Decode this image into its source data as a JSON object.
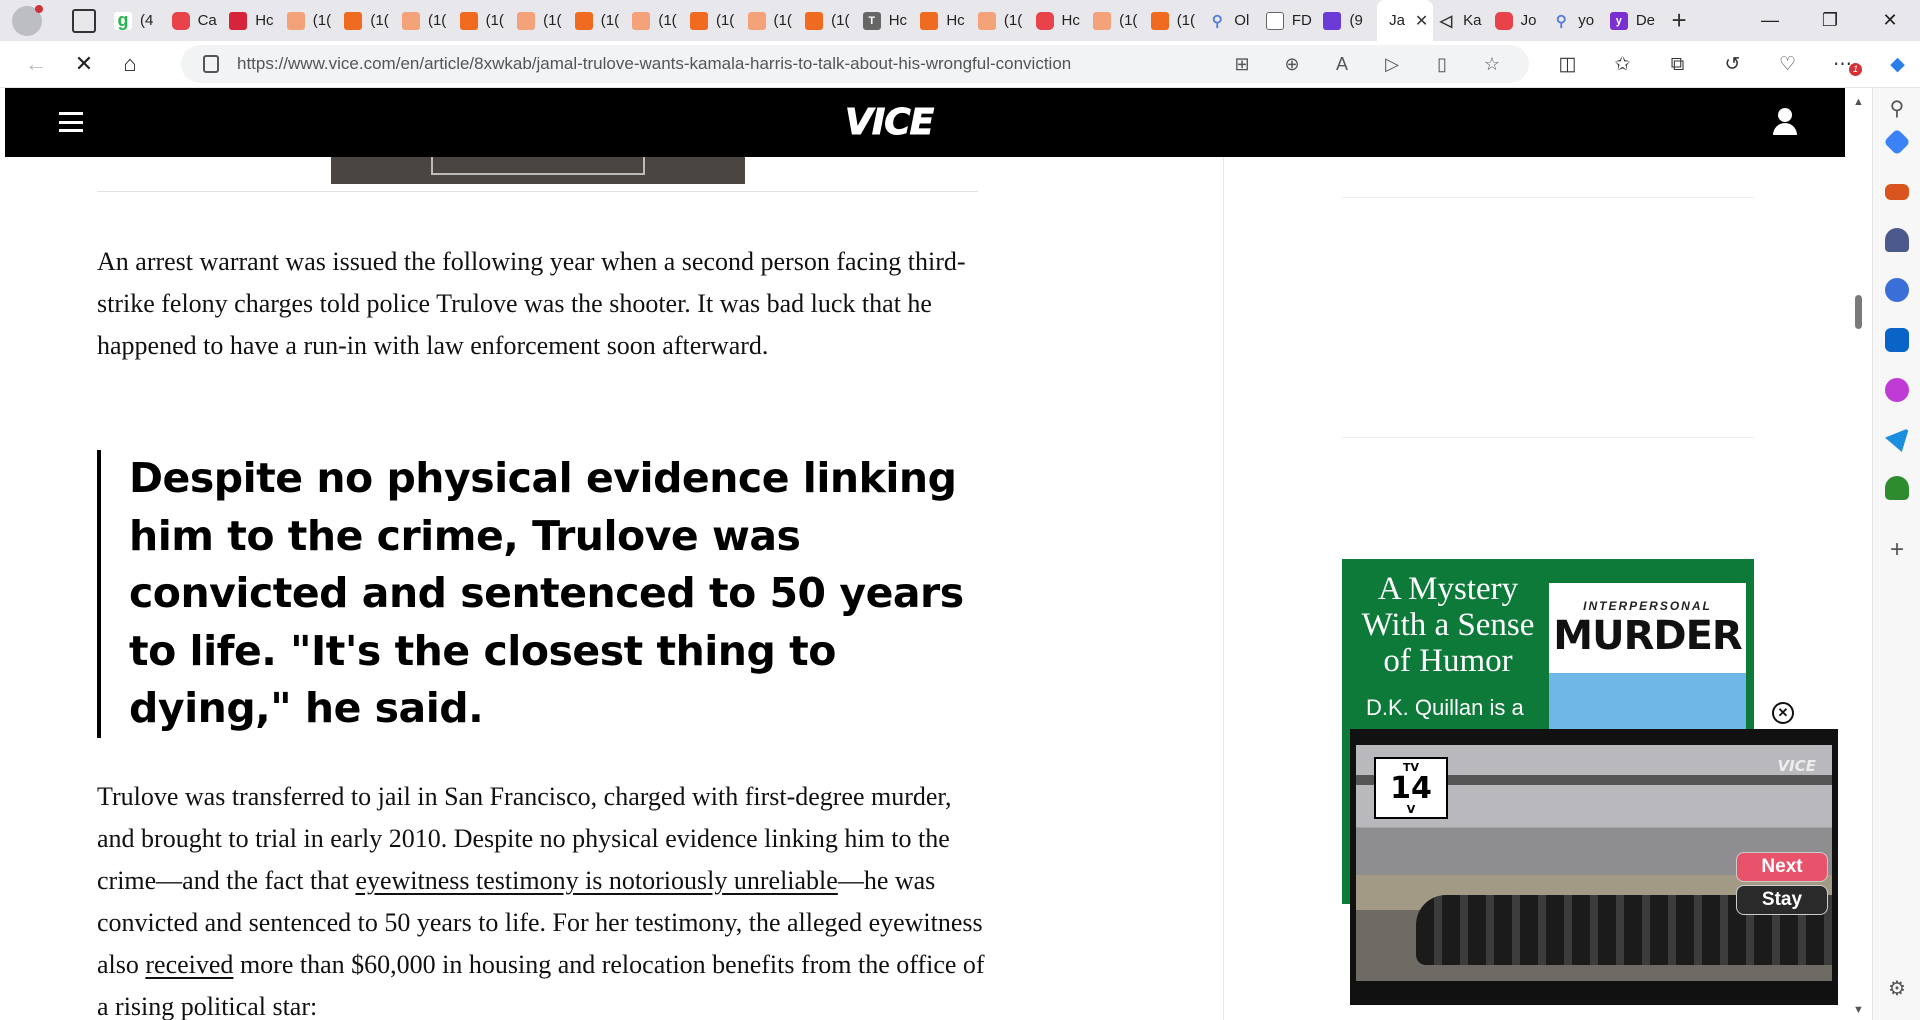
{
  "browser": {
    "tabs": [
      {
        "label": "(4",
        "icon": "grammarly-icon"
      },
      {
        "label": "Ca",
        "icon": "youtube-icon"
      },
      {
        "label": "Hc",
        "icon": "red-app-icon"
      },
      {
        "label": "(1(",
        "icon": "orange-app-icon"
      },
      {
        "label": "(1(",
        "icon": "orange-app-icon"
      },
      {
        "label": "(1(",
        "icon": "orange-app-icon"
      },
      {
        "label": "(1(",
        "icon": "orange-app-icon"
      },
      {
        "label": "(1(",
        "icon": "orange-app-icon"
      },
      {
        "label": "(1(",
        "icon": "orange-app-icon"
      },
      {
        "label": "(1(",
        "icon": "orange-app-icon"
      },
      {
        "label": "(1(",
        "icon": "orange-app-icon"
      },
      {
        "label": "(1(",
        "icon": "orange-app-icon"
      },
      {
        "label": "(1(",
        "icon": "orange-app-icon"
      },
      {
        "label": "Hc",
        "icon": "text-app-icon"
      },
      {
        "label": "Hc",
        "icon": "orange-app-icon"
      },
      {
        "label": "(1(",
        "icon": "orange-app-icon"
      },
      {
        "label": "Hc",
        "icon": "youtube-icon"
      },
      {
        "label": "(1(",
        "icon": "orange-app-icon"
      },
      {
        "label": "(1(",
        "icon": "orange-app-icon"
      },
      {
        "label": "Ol",
        "icon": "search-icon"
      },
      {
        "label": "FD",
        "icon": "document-icon"
      },
      {
        "label": "(9",
        "icon": "mail-icon"
      }
    ],
    "active_tab": {
      "label": "Ja",
      "close": "✕"
    },
    "tabs_after": [
      {
        "label": "Ka",
        "icon": "speaker-icon"
      },
      {
        "label": "Jo",
        "icon": "youtube-icon"
      },
      {
        "label": "yo",
        "icon": "search-icon"
      },
      {
        "label": "De",
        "icon": "yahoo-icon"
      }
    ],
    "new_tab": "+",
    "window": {
      "minimize": "—",
      "restore": "❐",
      "close": "✕"
    },
    "url_host": "https://www.vice.com",
    "url_path": "/en/article/8xwkab/jamal-trulove-wants-kamala-harris-to-talk-about-his-wrongful-conviction",
    "notification_count": "1"
  },
  "site": {
    "logo": "VICE",
    "paragraph1": "An arrest warrant was issued the following year when a second person facing third-strike felony charges told police Trulove was the shooter. It was bad luck that he happened to have a run-in with law enforcement soon afterward.",
    "pullquote": "Despite no physical evidence linking him to the crime, Trulove was convicted and sentenced to 50 years to life. \"It's the closest thing to dying,\" he said.",
    "paragraph2": {
      "part1": "Trulove was transferred to jail in San Francisco, charged with first-degree murder, and brought to trial in early 2010. Despite no physical evidence linking him to the crime—and the fact that ",
      "link1": "eyewitness testimony is notoriously unreliable",
      "part2": "—he was convicted and sentenced to 50 years to life. For her testimony, the alleged eyewitness also ",
      "link2": "received",
      "part3": " more than $60,000 in housing and relocation benefits from the office of a rising political star:"
    }
  },
  "ad": {
    "headline": "A Mystery With a Sense of Humor",
    "subline": "D.K. Quillan is a",
    "book_kicker": "INTERPERSONAL",
    "book_title": "MURDER"
  },
  "video": {
    "rating_top": "TV",
    "rating_num": "14",
    "rating_bottom": "V",
    "watermark": "VICE",
    "next_label": "Next",
    "stay_label": "Stay",
    "close": "✕"
  }
}
